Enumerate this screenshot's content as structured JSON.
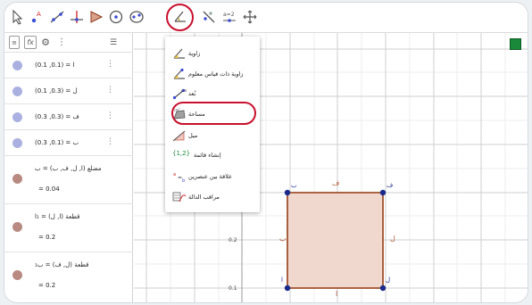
{
  "algebra": {
    "rows": [
      {
        "text": "(0.1 ,0.1) = ا",
        "color": "blue"
      },
      {
        "text": "(0.1 ,0.3) = ل",
        "color": "blue"
      },
      {
        "text": "(0.3 ,0.3) = ف",
        "color": "blue"
      },
      {
        "text": "(0.3 ,0.1) = ب",
        "color": "blue"
      },
      {
        "text": "مضلع (ا, ل, ف, ب) = ب",
        "value": "= 0.04",
        "color": "brown"
      },
      {
        "text": "قطعة (ا, ل) = ₁ا",
        "value": "= 0.2",
        "color": "brown"
      },
      {
        "text": "قطعة (ل, ف) = ب₁",
        "value": "= 0.2",
        "color": "brown"
      }
    ],
    "menu_glyph": "⋮"
  },
  "dropdown": {
    "items": [
      {
        "label": "زاوية",
        "icon": "angle-icon"
      },
      {
        "label": "زاوية ذات قياس معلوم",
        "icon": "angle-given-size-icon"
      },
      {
        "label": "بُعد",
        "icon": "distance-icon"
      },
      {
        "label": "مساحة",
        "icon": "area-icon"
      },
      {
        "label": "ميل",
        "icon": "slope-icon"
      },
      {
        "label": "إنشاء قائمة",
        "icon": "create-list-icon",
        "icon_text": "{1,2}"
      },
      {
        "label": "علاقة بين عنصرين",
        "icon": "relation-icon"
      },
      {
        "label": "مراقب الدالة",
        "icon": "function-inspector-icon"
      }
    ]
  },
  "graphics": {
    "y_ticks": [
      "0.2",
      "0.1"
    ],
    "points": [
      "ب",
      "ف",
      "ا",
      "ل"
    ],
    "sides": [
      "ف",
      "ب",
      "ل",
      "ا"
    ]
  },
  "colors": {
    "accent_ring": "#c8102e",
    "polygon_fill": "#f1d8cf",
    "polygon_stroke": "#a0522d",
    "point": "#1a2a8a"
  }
}
